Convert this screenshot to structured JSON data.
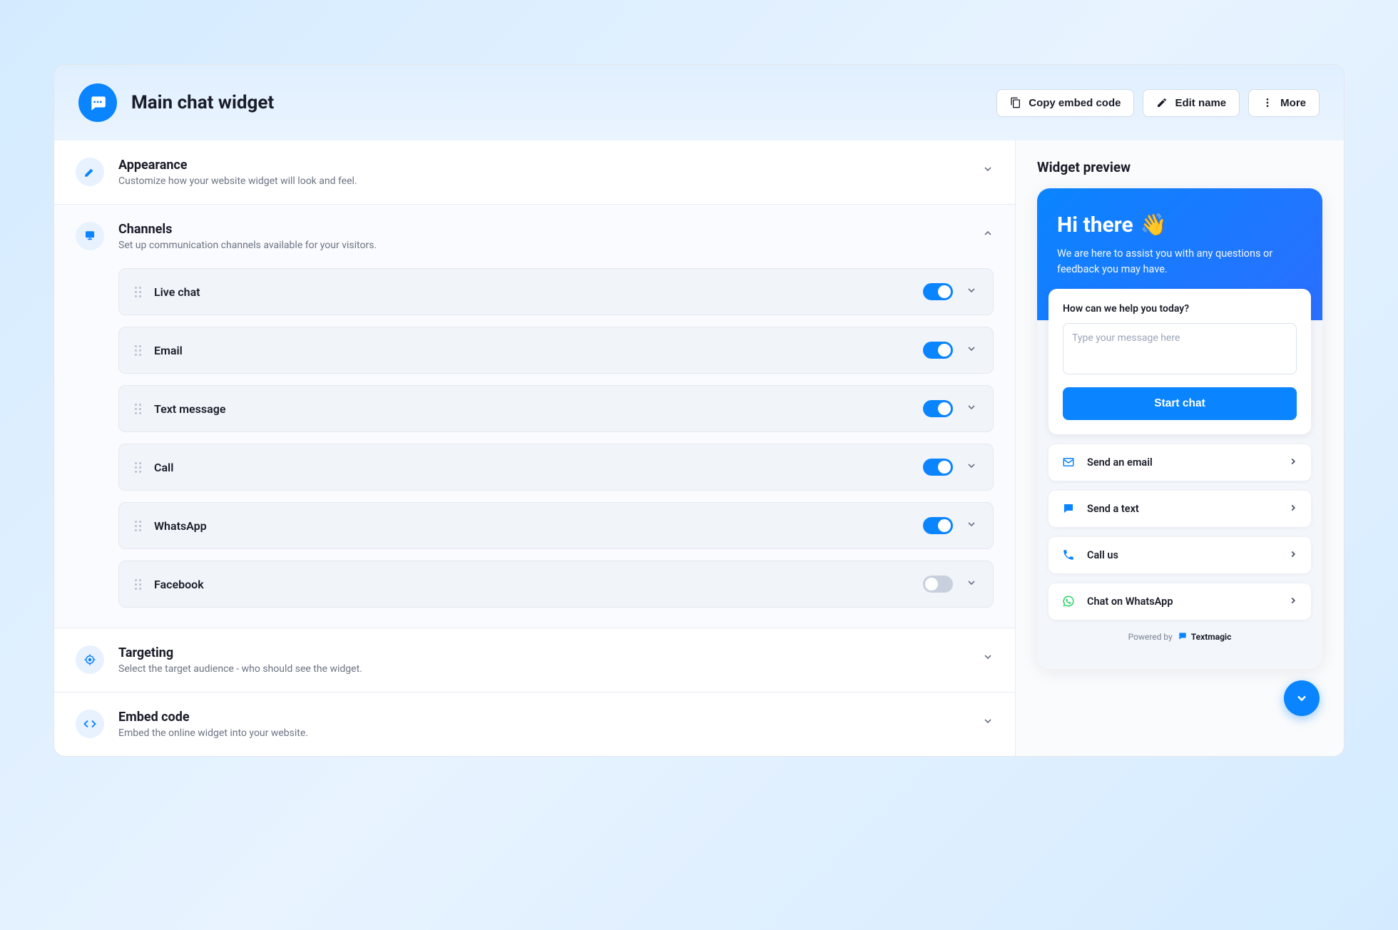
{
  "header": {
    "title": "Main chat widget",
    "copy_embed_label": "Copy embed code",
    "edit_name_label": "Edit name",
    "more_label": "More"
  },
  "sections": {
    "appearance": {
      "title": "Appearance",
      "desc": "Customize how your website widget will look and feel."
    },
    "channels": {
      "title": "Channels",
      "desc": "Set up communication channels available for your visitors.",
      "items": [
        {
          "label": "Live chat",
          "enabled": true
        },
        {
          "label": "Email",
          "enabled": true
        },
        {
          "label": "Text message",
          "enabled": true
        },
        {
          "label": "Call",
          "enabled": true
        },
        {
          "label": "WhatsApp",
          "enabled": true
        },
        {
          "label": "Facebook",
          "enabled": false
        }
      ]
    },
    "targeting": {
      "title": "Targeting",
      "desc": "Select the target audience - who should see the widget."
    },
    "embed": {
      "title": "Embed code",
      "desc": "Embed the online widget into your website."
    }
  },
  "preview": {
    "title": "Widget preview",
    "greeting": "Hi there",
    "wave": "👋",
    "subtext": "We are here to assist you with any questions or feedback you may have.",
    "question": "How can we help you today?",
    "placeholder": "Type your message here",
    "start_label": "Start chat",
    "options": [
      {
        "label": "Send an email",
        "icon": "email"
      },
      {
        "label": "Send a text",
        "icon": "text"
      },
      {
        "label": "Call us",
        "icon": "call"
      },
      {
        "label": "Chat on WhatsApp",
        "icon": "whatsapp"
      }
    ],
    "footer_prefix": "Powered by",
    "footer_brand": "Textmagic"
  }
}
